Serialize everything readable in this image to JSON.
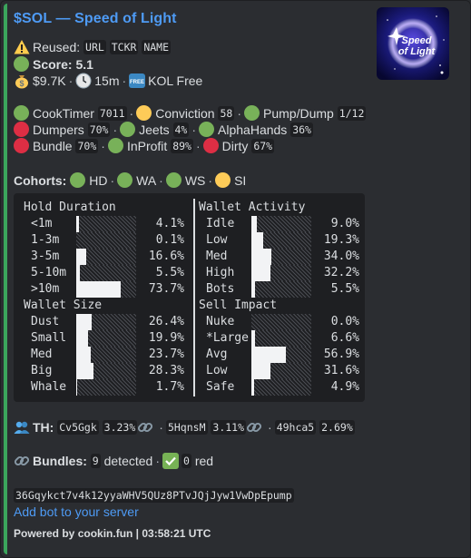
{
  "title": "$SOL — Speed of Light",
  "thumbnail": {
    "text_top": "Speed",
    "text_bottom": "of Light"
  },
  "reused": {
    "label": "Reused:",
    "tags": [
      "URL",
      "TCKR",
      "NAME"
    ]
  },
  "score": {
    "label": "Score: 5.1"
  },
  "stats": {
    "mcap": "$9.7K",
    "age": "15m",
    "kol": "KOL Free"
  },
  "metrics": [
    {
      "label": "CookTimer",
      "value": "7011",
      "color": "green"
    },
    {
      "label": "Conviction",
      "value": "58",
      "color": "yellow"
    },
    {
      "label": "Pump/Dump",
      "value": "1/12",
      "color": "green"
    },
    {
      "label": "Dumpers",
      "value": "70%",
      "color": "red"
    },
    {
      "label": "Jeets",
      "value": "4%",
      "color": "green"
    },
    {
      "label": "AlphaHands",
      "value": "36%",
      "color": "green"
    },
    {
      "label": "Bundle",
      "value": "70%",
      "color": "red"
    },
    {
      "label": "InProfit",
      "value": "89%",
      "color": "green"
    },
    {
      "label": "Dirty",
      "value": "67%",
      "color": "red"
    }
  ],
  "cohorts": {
    "label": "Cohorts:",
    "items": [
      {
        "label": "HD",
        "color": "green"
      },
      {
        "label": "WA",
        "color": "green"
      },
      {
        "label": "WS",
        "color": "green"
      },
      {
        "label": "SI",
        "color": "yellow"
      }
    ]
  },
  "hold_duration": {
    "title": "Hold Duration",
    "rows": [
      {
        "label": "<1m",
        "pct": "4.1%",
        "fill": 0.041
      },
      {
        "label": "1-3m",
        "pct": "0.1%",
        "fill": 0.001
      },
      {
        "label": "3-5m",
        "pct": "16.6%",
        "fill": 0.166
      },
      {
        "label": "5-10m",
        "pct": "5.5%",
        "fill": 0.055
      },
      {
        "label": ">10m",
        "pct": "73.7%",
        "fill": 0.737
      }
    ]
  },
  "wallet_activity": {
    "title": "Wallet Activity",
    "rows": [
      {
        "label": "Idle",
        "pct": "9.0%",
        "fill": 0.09
      },
      {
        "label": "Low",
        "pct": "19.3%",
        "fill": 0.193
      },
      {
        "label": "Med",
        "pct": "34.0%",
        "fill": 0.34
      },
      {
        "label": "High",
        "pct": "32.2%",
        "fill": 0.322
      },
      {
        "label": "Bots",
        "pct": "5.5%",
        "fill": 0.055
      }
    ]
  },
  "wallet_size": {
    "title": "Wallet Size",
    "rows": [
      {
        "label": "Dust",
        "pct": "26.4%",
        "fill": 0.264
      },
      {
        "label": "Small",
        "pct": "19.9%",
        "fill": 0.199
      },
      {
        "label": "Med",
        "pct": "23.7%",
        "fill": 0.237
      },
      {
        "label": "Big",
        "pct": "28.3%",
        "fill": 0.283
      },
      {
        "label": "Whale",
        "pct": "1.7%",
        "fill": 0.017
      }
    ]
  },
  "sell_impact": {
    "title": "Sell Impact",
    "rows": [
      {
        "label": "Nuke",
        "pct": "0.0%",
        "fill": 0.0
      },
      {
        "label": "*Large",
        "pct": "6.6%",
        "fill": 0.066
      },
      {
        "label": "Avg",
        "pct": "56.9%",
        "fill": 0.569
      },
      {
        "label": "Low",
        "pct": "31.6%",
        "fill": 0.316
      },
      {
        "label": "Safe",
        "pct": "4.9%",
        "fill": 0.049
      }
    ]
  },
  "top_holders": {
    "label": "TH:",
    "items": [
      {
        "addr": "Cv5Ggk",
        "pct": "3.23%"
      },
      {
        "addr": "5HqnsM",
        "pct": "3.11%"
      },
      {
        "addr": "49hca5",
        "pct": "2.69%"
      }
    ]
  },
  "bundles": {
    "label": "Bundles:",
    "count": "9",
    "detected": "detected",
    "red_count": "0",
    "red": "red"
  },
  "contract": "36Gqykct7v4k12yyaWHV5QUz8PTvJQjJyw1VwDpEpump",
  "add_bot": "Add bot to your server",
  "footer": "Powered by cookin.fun | 03:58:21 UTC",
  "colors": {
    "green": "#78b159",
    "yellow": "#fdcb58",
    "red": "#dd2e44",
    "link": "#4e9bf5",
    "accent_bar": "#3ba55c"
  }
}
